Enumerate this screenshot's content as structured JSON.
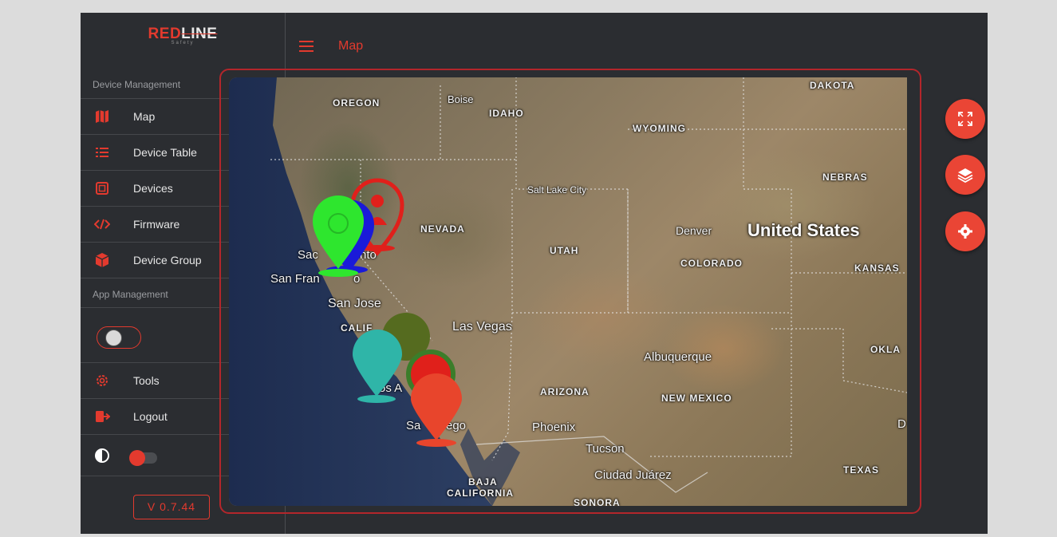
{
  "brand": {
    "logo_main_a": "RED",
    "logo_main_b": "LINE",
    "logo_sub": "Safety"
  },
  "sidebar": {
    "section_device": "Device Management",
    "section_app": "App Management",
    "items": [
      {
        "label": "Map",
        "icon": "map-icon"
      },
      {
        "label": "Device Table",
        "icon": "list-icon"
      },
      {
        "label": "Devices",
        "icon": "chip-icon"
      },
      {
        "label": "Firmware",
        "icon": "code-icon"
      },
      {
        "label": "Device Group",
        "icon": "cube-icon"
      }
    ],
    "app_items": [
      {
        "label": "Tools",
        "icon": "gear-icon"
      },
      {
        "label": "Logout",
        "icon": "logout-icon"
      }
    ],
    "version": "V 0.7.44"
  },
  "header": {
    "title": "Map"
  },
  "map": {
    "labels": {
      "oregon": "OREGON",
      "boise": "Boise",
      "idaho": "IDAHO",
      "wyoming": "WYOMING",
      "dakota": "DAKOTA",
      "nebraska": "NEBRAS",
      "salt_lake": "Salt Lake City",
      "nevada": "NEVADA",
      "utah": "UTAH",
      "denver": "Denver",
      "united_states": "United States",
      "colorado": "COLORADO",
      "kansas": "KANSAS",
      "sacramento": "Sac",
      "sacramento2": "nto",
      "san_francisco": "San Fran",
      "san_francisco2": "o",
      "san_jose": "San Jose",
      "california": "CALIF",
      "las_vegas": "Las Vegas",
      "albuquerque": "Albuquerque",
      "oklahoma": "OKLA",
      "los_angeles": "os A",
      "arizona": "ARIZONA",
      "new_mexico": "NEW MEXICO",
      "san_diego": "Sa",
      "san_diego2": "ego",
      "phoenix": "Phoenix",
      "d": "D",
      "tucson": "Tucson",
      "ciudad_juarez": "Ciudad Juárez",
      "texas": "TEXAS",
      "baja": "BAJA",
      "baja2": "CALIFORNIA",
      "sonora": "SONORA"
    },
    "controls": [
      {
        "icon": "fullscreen-icon"
      },
      {
        "icon": "layers-icon"
      },
      {
        "icon": "settings-icon"
      }
    ],
    "colors": {
      "accent": "#e33a2e",
      "marker_green": "#2ee62e",
      "marker_blue": "#1a1ad9",
      "marker_red": "#e0201b",
      "marker_olive": "#556b1f",
      "marker_teal": "#2fb5a8",
      "marker_orange": "#e8452c"
    }
  }
}
